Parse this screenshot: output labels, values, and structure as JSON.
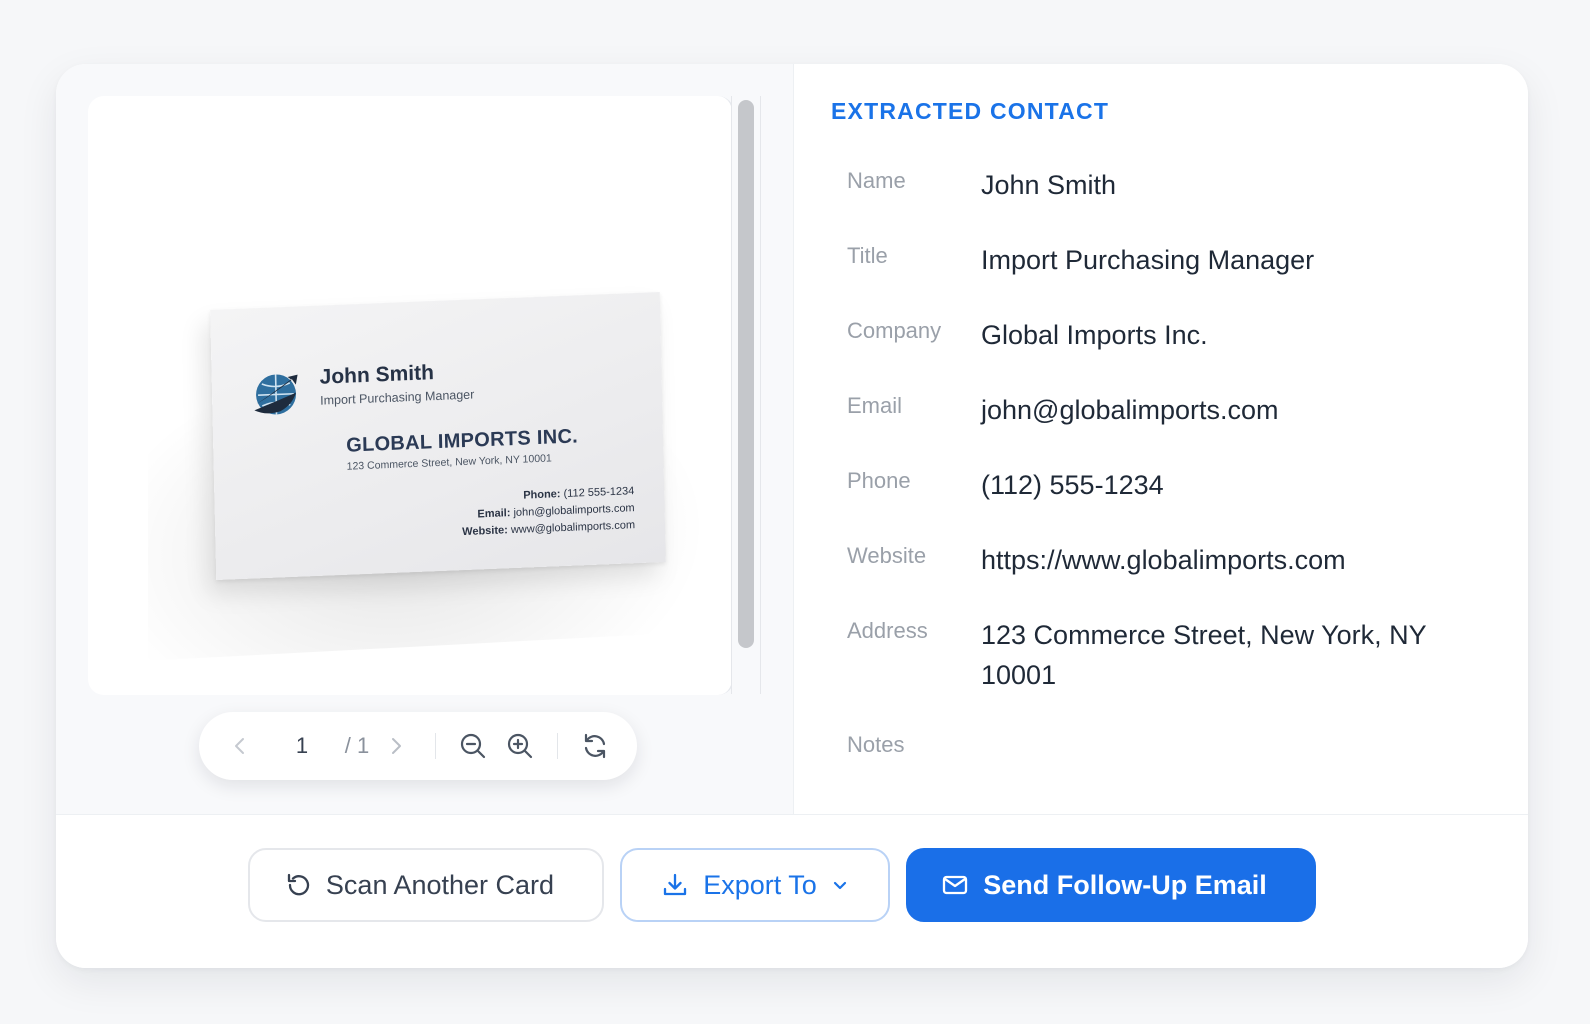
{
  "business_card_image": {
    "name": "John Smith",
    "title": "Import Purchasing Manager",
    "company": "GLOBAL IMPORTS INC.",
    "address": "123 Commerce Street, New York, NY 10001",
    "phone_label": "Phone:",
    "phone": "(112 555-1234",
    "email_label": "Email:",
    "email": "john@globalimports.com",
    "website_label": "Website:",
    "website": "www@globalimports.com"
  },
  "viewer_toolbar": {
    "current_page": "1",
    "total_pages": "/ 1",
    "icons": [
      "chevron-left-icon",
      "chevron-right-icon",
      "zoom-out-icon",
      "zoom-in-icon",
      "rotate-icon"
    ]
  },
  "extracted": {
    "section_title": "EXTRACTED CONTACT",
    "fields": [
      {
        "label": "Name",
        "value": "John Smith"
      },
      {
        "label": "Title",
        "value": "Import Purchasing Manager"
      },
      {
        "label": "Company",
        "value": "Global Imports Inc."
      },
      {
        "label": "Email",
        "value": "john@globalimports.com"
      },
      {
        "label": "Phone",
        "value": "(112) 555-1234"
      },
      {
        "label": "Website",
        "value": "https://www.globalimports.com"
      },
      {
        "label": "Address",
        "value": "123 Commerce Street, New York, NY 10001"
      },
      {
        "label": "Notes",
        "value": ""
      }
    ]
  },
  "actions": {
    "scan_label": "Scan Another Card",
    "export_label": "Export To",
    "send_label": "Send Follow-Up Email"
  },
  "colors": {
    "accent": "#1a73e8",
    "primary_button": "#1a6fe8",
    "label_gray": "#9aa0a9",
    "text_dark": "#1f2937"
  }
}
